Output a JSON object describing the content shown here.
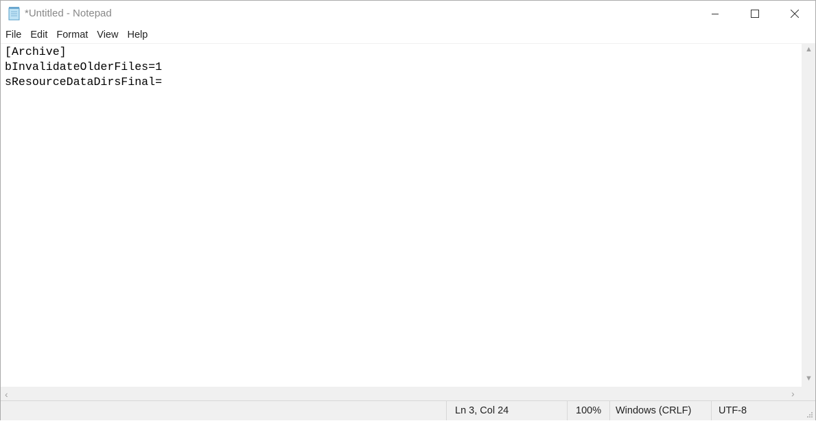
{
  "window": {
    "title": "*Untitled - Notepad"
  },
  "menu": [
    "File",
    "Edit",
    "Format",
    "View",
    "Help"
  ],
  "editor": {
    "lines": [
      "[Archive]",
      "bInvalidateOlderFiles=1",
      "sResourceDataDirsFinal="
    ]
  },
  "status": {
    "position": "Ln 3, Col 24",
    "zoom": "100%",
    "line_ending": "Windows (CRLF)",
    "encoding": "UTF-8"
  },
  "icons": {
    "app": "notepad-icon",
    "minimize": "minimize-icon",
    "maximize": "maximize-icon",
    "close": "close-icon"
  }
}
